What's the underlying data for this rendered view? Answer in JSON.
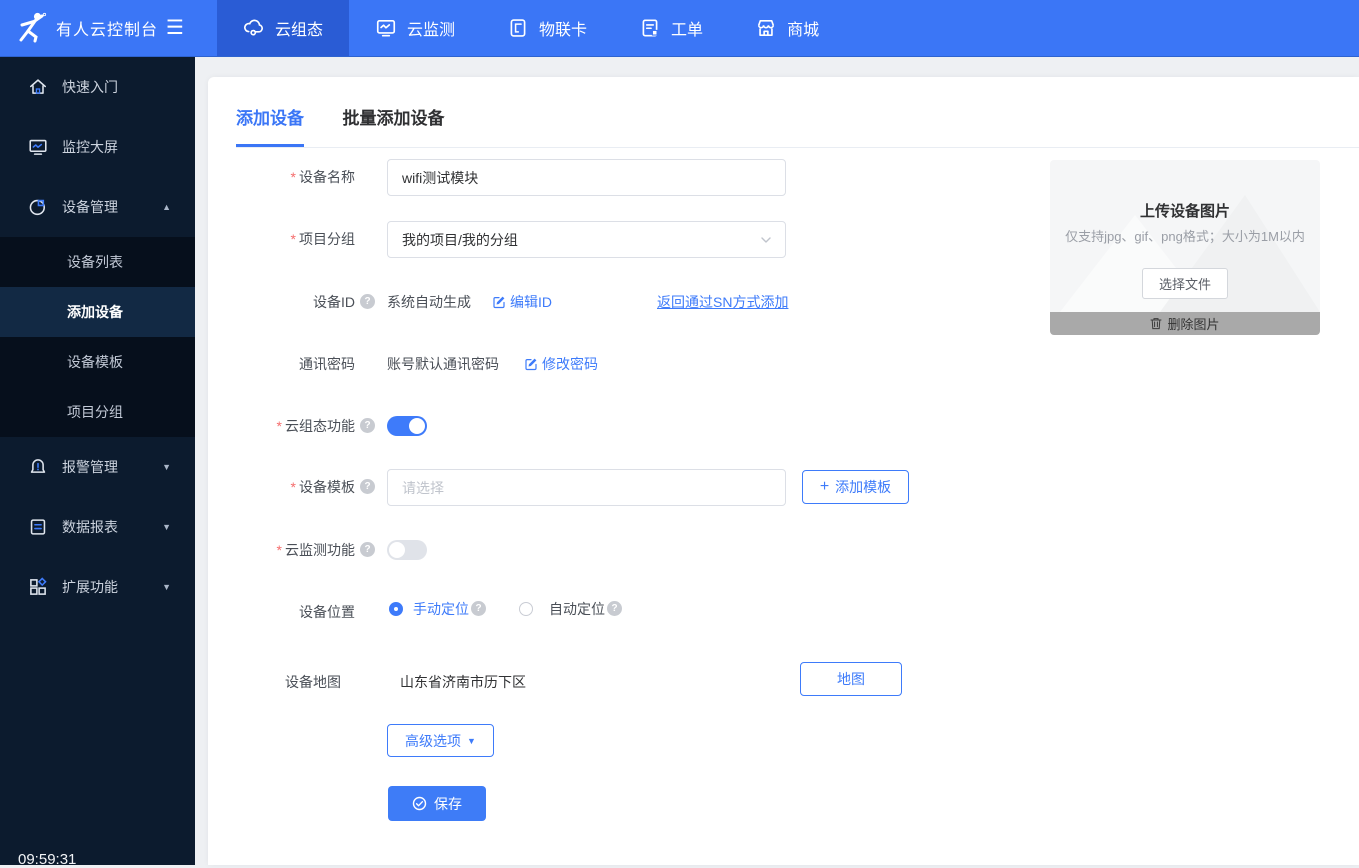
{
  "navbar": {
    "logo_text": "有人云控制台",
    "items": [
      {
        "label": "云组态",
        "active": true
      },
      {
        "label": "云监测",
        "active": false
      },
      {
        "label": "物联卡",
        "active": false
      },
      {
        "label": "工单",
        "active": false
      },
      {
        "label": "商城",
        "active": false
      }
    ]
  },
  "sidebar": {
    "items": [
      {
        "label": "快速入门"
      },
      {
        "label": "监控大屏"
      },
      {
        "label": "设备管理",
        "expanded": true
      },
      {
        "label": "报警管理"
      },
      {
        "label": "数据报表"
      },
      {
        "label": "扩展功能"
      }
    ],
    "submenu": [
      {
        "label": "设备列表",
        "active": false
      },
      {
        "label": "添加设备",
        "active": true
      },
      {
        "label": "设备模板",
        "active": false
      },
      {
        "label": "项目分组",
        "active": false
      }
    ],
    "timestamp": "09:59:31"
  },
  "tabs": [
    {
      "label": "添加设备",
      "active": true
    },
    {
      "label": "批量添加设备",
      "active": false
    }
  ],
  "form": {
    "required_mark": "*",
    "device_name": {
      "label": "设备名称",
      "value": "wifi测试模块"
    },
    "project_group": {
      "label": "项目分组",
      "value": "我的项目/我的分组"
    },
    "device_id": {
      "label": "设备ID",
      "text": "系统自动生成",
      "edit_link": "编辑ID",
      "sn_link": "返回通过SN方式添加"
    },
    "comm_password": {
      "label": "通讯密码",
      "text": "账号默认通讯密码",
      "edit_link": "修改密码"
    },
    "scada": {
      "label": "云组态功能",
      "state": "on"
    },
    "device_template": {
      "label": "设备模板",
      "placeholder": "请选择",
      "add_button": "添加模板"
    },
    "cloud_monitor": {
      "label": "云监测功能",
      "state": "off"
    },
    "device_location": {
      "label": "设备位置",
      "manual": "手动定位",
      "auto": "自动定位"
    },
    "device_map": {
      "label": "设备地图",
      "address": "山东省济南市历下区",
      "map_button": "地图"
    },
    "advanced_button": "高级选项",
    "save_button": "保存"
  },
  "upload": {
    "title": "上传设备图片",
    "hint": "仅支持jpg、gif、png格式；大小为1M以内",
    "choose_button": "选择文件",
    "delete_label": "删除图片"
  },
  "icons": {
    "question": "?",
    "plus": "+",
    "caret_down": "▼",
    "caret_up": "▲",
    "hamburger": "☰"
  },
  "colors": {
    "primary": "#3b76f6",
    "nav_active": "#2a5cd5",
    "sidebar_bg": "#0c1b2e",
    "link": "#3e7bfa",
    "arrow_red": "#e8220b",
    "toggle_off": "#e0e3e9"
  }
}
